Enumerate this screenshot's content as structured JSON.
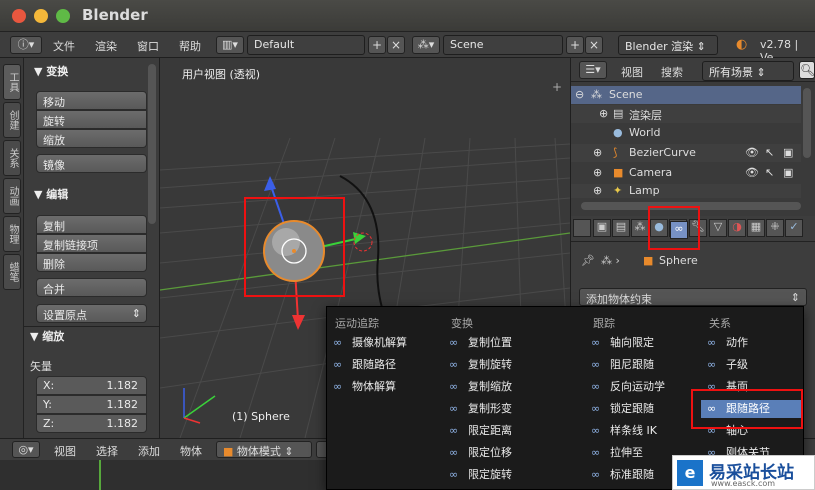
{
  "window": {
    "title": "Blender"
  },
  "topbar": {
    "menus": [
      "文件",
      "渲染",
      "窗口",
      "帮助"
    ],
    "layout": "Default",
    "scene": "Scene",
    "engine": "Blender 渲染",
    "version": "v2.78 | Ve"
  },
  "left_tabs": [
    "工具",
    "创建",
    "关系",
    "动画",
    "物理",
    "蜡笔"
  ],
  "toolshelf": {
    "transform_header": "▼ 变换",
    "transform": [
      "移动",
      "旋转",
      "缩放"
    ],
    "mirror": "镜像",
    "edit_header": "▼ 编辑",
    "edit": [
      "复制",
      "复制链接项",
      "删除"
    ],
    "join": "合并",
    "origin": "设置原点",
    "scale_header": "▼ 缩放",
    "vector_label": "矢量",
    "vector": [
      {
        "axis": "X:",
        "value": "1.182"
      },
      {
        "axis": "Y:",
        "value": "1.182"
      },
      {
        "axis": "Z:",
        "value": "1.182"
      }
    ]
  },
  "viewport": {
    "label": "用户视图 (透视)",
    "object_label": "(1) Sphere"
  },
  "outliner": {
    "view": "视图",
    "search": "搜索",
    "filter": "所有场景",
    "items": [
      {
        "name": "Scene"
      },
      {
        "name": "渲染层"
      },
      {
        "name": "World"
      },
      {
        "name": "BezierCurve"
      },
      {
        "name": "Camera"
      },
      {
        "name": "Lamp"
      }
    ]
  },
  "properties": {
    "object": "Sphere",
    "add_constraint": "添加物体约束"
  },
  "bottombar": {
    "items": [
      "视图",
      "选择",
      "添加",
      "物体"
    ],
    "mode": "物体模式"
  },
  "popup": {
    "columns": [
      {
        "header": "运动追踪",
        "items": [
          "摄像机解算",
          "跟随路径",
          "物体解算"
        ]
      },
      {
        "header": "变换",
        "items": [
          "复制位置",
          "复制旋转",
          "复制缩放",
          "复制形变",
          "限定距离",
          "限定位移",
          "限定旋转"
        ]
      },
      {
        "header": "跟踪",
        "items": [
          "轴向限定",
          "阻尼跟随",
          "反向运动学",
          "锁定跟随",
          "样条线 IK",
          "拉伸至",
          "标准跟随"
        ]
      },
      {
        "header": "关系",
        "items": [
          "动作",
          "子级",
          "基面",
          "跟随路径",
          "轴心",
          "刚体关节"
        ]
      }
    ]
  },
  "watermark": {
    "text": "易采站长站",
    "sub": "www.easck.com"
  },
  "colors": {
    "accent_blue": "#5a7fb8",
    "highlight_red": "#e11111",
    "active_orange": "#e88a2c"
  }
}
